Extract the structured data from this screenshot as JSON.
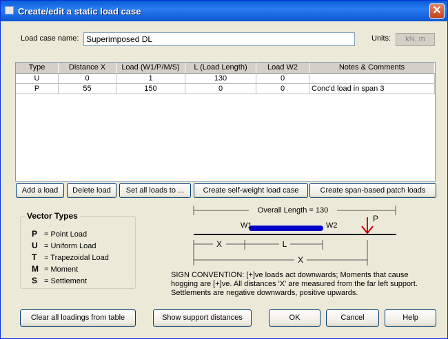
{
  "window": {
    "title": "Create/edit a static load case",
    "close_glyph": "✕"
  },
  "form": {
    "load_case_label": "Load case name:",
    "load_case_value": "Superimposed DL",
    "units_label": "Units:",
    "units_value": "kN, m"
  },
  "table": {
    "columns": [
      "Type",
      "Distance X",
      "Load (W1/P/M/S)",
      "L  (Load Length)",
      "Load W2",
      "Notes & Comments"
    ],
    "rows": [
      [
        "U",
        "0",
        "1",
        "130",
        "0",
        ""
      ],
      [
        "P",
        "55",
        "150",
        "0",
        "0",
        "Conc'd load in span 3"
      ]
    ]
  },
  "table_buttons": {
    "add": "Add a load",
    "delete": "Delete load",
    "set_all": "Set all loads to ...",
    "self_weight": "Create self-weight load case",
    "span_patch": "Create span-based patch loads"
  },
  "vector_types": {
    "title": "Vector Types",
    "items": [
      {
        "key": "P",
        "desc": "=  Point Load"
      },
      {
        "key": "U",
        "desc": "=  Uniform Load"
      },
      {
        "key": "T",
        "desc": "=  Trapezoidal Load"
      },
      {
        "key": "M",
        "desc": "=  Moment"
      },
      {
        "key": "S",
        "desc": "=  Settlement"
      }
    ]
  },
  "diagram": {
    "overall": "Overall Length = 130",
    "w1": "W1",
    "w2": "W2",
    "p": "P",
    "x": "X",
    "l": "L",
    "x2": "X",
    "load_color": "#0000c8",
    "arrow_color": "#c00000"
  },
  "sign_convention": {
    "line1": "SIGN CONVENTION:  [+]ve loads act downwards;  Moments that cause",
    "line2": "hogging are [+]ve.  All distances 'X' are measured from the far left support.",
    "line3": "Settlements are negative downwards, positive upwards."
  },
  "footer": {
    "clear": "Clear all loadings from table",
    "show_support": "Show support distances",
    "ok": "OK",
    "cancel": "Cancel",
    "help": "Help"
  }
}
